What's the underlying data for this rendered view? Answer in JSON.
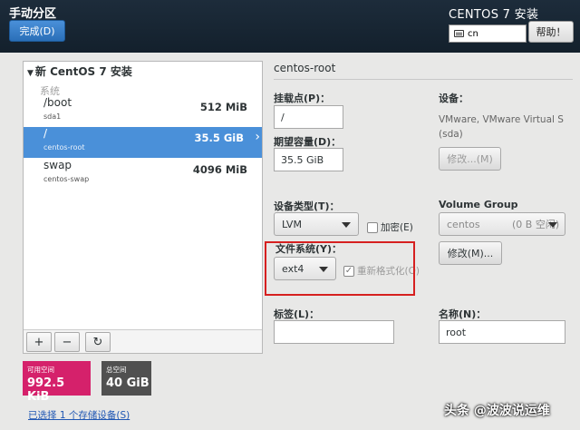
{
  "header": {
    "title": "手动分区",
    "done_label": "完成(D)",
    "product": "CENTOS 7 安装",
    "keyboard_layout": "cn",
    "help_label": "帮助！"
  },
  "tree": {
    "root_label": "新 CentOS 7 安装",
    "system_label": "系统",
    "mounts": [
      {
        "mount": "/boot",
        "device": "sda1",
        "size": "512 MiB"
      },
      {
        "mount": "/",
        "device": "centos-root",
        "size": "35.5 GiB"
      },
      {
        "mount": "swap",
        "device": "centos-swap",
        "size": "4096 MiB"
      }
    ],
    "add_label": "+",
    "remove_label": "−",
    "refresh_label": "↻"
  },
  "space": {
    "available_label": "可用空间",
    "available_value": "992.5 KiB",
    "total_label": "总空间",
    "total_value": "40 GiB"
  },
  "storage_link": "已选择 1 个存储设备(S)",
  "detail": {
    "partition_name": "centos-root",
    "mount_point_label": "挂载点(P)：",
    "mount_point_value": "/",
    "capacity_label": "期望容量(D)：",
    "capacity_value": "35.5 GiB",
    "device_label": "设备：",
    "device_info": "VMware, VMware Virtual S (sda)",
    "modify_device_label": "修改...(M)",
    "device_type_label": "设备类型(T)：",
    "device_type_value": "LVM",
    "encrypt_label": "加密(E)",
    "volume_group_label": "Volume Group",
    "volume_group_value": "centos",
    "volume_group_free": "(0 B 空闲)",
    "modify_vg_label": "修改(M)...",
    "filesystem_label": "文件系统(Y)：",
    "filesystem_value": "ext4",
    "reformat_label": "重新格式化(O)",
    "tag_label": "标签(L)：",
    "tag_value": "",
    "name_label": "名称(N)：",
    "name_value": "root"
  },
  "watermark": "头条 @波波说运维",
  "colors": {
    "header_bg": "#1d2c3b",
    "selected_row": "#4a90d9",
    "available_bg": "#d5216b",
    "total_bg": "#505050",
    "highlight_rect": "#d62020"
  }
}
